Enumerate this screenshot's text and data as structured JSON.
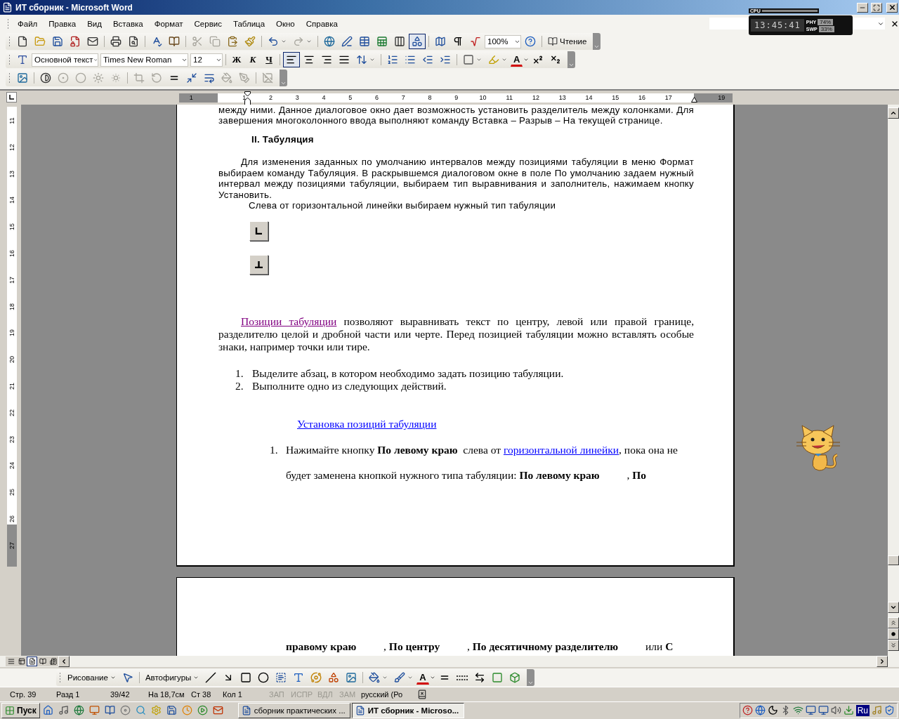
{
  "window": {
    "title": "ИТ сборник - Microsoft Word"
  },
  "system_monitor": {
    "cpu_label": "CPU",
    "time": "13:45:41",
    "phy_label": "PHY",
    "phy_value": "74%",
    "swp_label": "SWP",
    "swp_value": "33%"
  },
  "menu": [
    "Файл",
    "Правка",
    "Вид",
    "Вставка",
    "Формат",
    "Сервис",
    "Таблица",
    "Окно",
    "Справка"
  ],
  "standard_toolbar": {
    "drawing_pressed": true,
    "zoom": "100%",
    "read_label": "Чтение"
  },
  "formatting_toolbar": {
    "style": "Основной текст",
    "font": "Times New Roman",
    "size": "12",
    "bold_label": "Ж",
    "italic_label": "К",
    "underline_label": "Ч",
    "alignment": [
      {
        "selected": true
      },
      {
        "selected": false
      },
      {
        "selected": false
      },
      {
        "selected": false
      }
    ],
    "font_color_label": "A"
  },
  "ruler": {
    "numbers": [
      "1",
      "1",
      "2",
      "3",
      "4",
      "5",
      "6",
      "7",
      "8",
      "9",
      "10",
      "11",
      "12",
      "13",
      "14",
      "15",
      "16",
      "17",
      "19"
    ]
  },
  "vertical_ruler": {
    "numbers": [
      "11",
      "12",
      "13",
      "14",
      "15",
      "16",
      "17",
      "18",
      "19",
      "20",
      "21",
      "22",
      "23",
      "24",
      "25",
      "26",
      "27"
    ]
  },
  "document": {
    "continued_text": "между ними. Данное диалоговое окно дает возможность установить разделитель между колонками. Для завершения многоколонного ввода выполняют команду Вставка – Разрыв – На текущей странице.",
    "heading": "II. Табуляция",
    "paragraph": "Для изменения заданных по умолчанию интервалов между позициями табуляции в меню Формат выбираем команду Табуляция. В раскрывшемся диалоговом окне в поле По умолчанию задаем нужный интервал между позициями табуляции, выбираем тип выравнивания и заполнитель, нажимаем кнопку Установить.",
    "instruction": "Слева от горизонтальной линейки выбираем нужный тип табуляции",
    "tab_buttons": [
      {
        "kind": "left"
      },
      {
        "kind": "center"
      }
    ],
    "tab_paragraph": {
      "link": "Позиции табуляции",
      "text": " позволяют выравнивать текст по центру, левой или правой границе, разделителю целой и дробной части или черте. Перед позицией табуляции можно вставлять особые знаки, например точки или тире."
    },
    "steps": [
      {
        "number": "1.",
        "text": "Выделите абзац, в котором необходимо задать позицию табуляции."
      },
      {
        "number": "2.",
        "text": "Выполните одно из следующих действий."
      }
    ],
    "section_link": "Установка позиций табуляции",
    "substeps": [
      {
        "number": "1.",
        "segments": [
          {
            "kind": "text",
            "text": "Нажимайте кнопку **По левому краю**  слева от "
          },
          {
            "kind": "link",
            "text": "горизонтальной линейки"
          },
          {
            "kind": "text",
            "text": ", пока она не будет заменена кнопкой нужного типа табуляции: **По левому краю**          , **По**"
          }
        ]
      }
    ],
    "page_2_line": "**правому краю**          , **По центру**          , **По десятичному разделителю**          или **С**"
  },
  "view_buttons": [
    {
      "selected": false
    },
    {
      "selected": false
    },
    {
      "selected": true
    },
    {
      "selected": false
    },
    {
      "selected": false
    }
  ],
  "drawing_toolbar": {
    "draw_label": "Рисование",
    "autoshapes_label": "Автофигуры",
    "font_color_label": "A"
  },
  "status_bar": {
    "items": [
      "Стр. 39",
      "Разд 1",
      "39/42",
      "На 18,7см",
      "Ст 38",
      "Кол 1"
    ],
    "modes": [
      {
        "text": "ЗАП",
        "disabled": true
      },
      {
        "text": "ИСПР",
        "disabled": true
      },
      {
        "text": "ВДЛ",
        "disabled": true
      },
      {
        "text": "ЗАМ",
        "disabled": true
      }
    ],
    "language": "русский (Ро"
  },
  "taskbar": {
    "start_label": "Пуск",
    "tasks": [
      {
        "label": "сборник практических ...",
        "selected": false
      },
      {
        "label": "ИТ сборник - Microso...",
        "selected": true
      }
    ],
    "language": "Ru"
  }
}
